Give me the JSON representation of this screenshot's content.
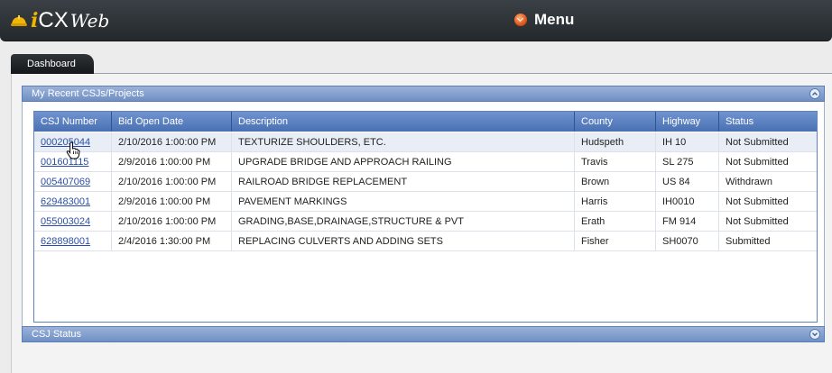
{
  "app": {
    "logo_i": "i",
    "logo_cx": "CX",
    "logo_web": "Web",
    "menu_label": "Menu"
  },
  "tabs": [
    {
      "label": "Dashboard",
      "active": true
    }
  ],
  "recent_panel": {
    "title": "My Recent CSJs/Projects",
    "columns": [
      "CSJ Number",
      "Bid Open Date",
      "Description",
      "County",
      "Highway",
      "Status"
    ],
    "rows": [
      {
        "csj": "000205044",
        "bid_open_date": "2/10/2016 1:00:00 PM",
        "description": "TEXTURIZE SHOULDERS, ETC.",
        "county": "Hudspeth",
        "highway": "IH 10",
        "status": "Not Submitted"
      },
      {
        "csj": "001601115",
        "bid_open_date": "2/9/2016 1:00:00 PM",
        "description": "UPGRADE BRIDGE AND APPROACH RAILING",
        "county": "Travis",
        "highway": "SL 275",
        "status": "Not Submitted"
      },
      {
        "csj": "005407069",
        "bid_open_date": "2/10/2016 1:00:00 PM",
        "description": "RAILROAD BRIDGE REPLACEMENT",
        "county": "Brown",
        "highway": "US 84",
        "status": "Withdrawn"
      },
      {
        "csj": "629483001",
        "bid_open_date": "2/9/2016 1:00:00 PM",
        "description": "PAVEMENT MARKINGS",
        "county": "Harris",
        "highway": "IH0010",
        "status": "Not Submitted"
      },
      {
        "csj": "055003024",
        "bid_open_date": "2/10/2016 1:00:00 PM",
        "description": "GRADING,BASE,DRAINAGE,STRUCTURE & PVT",
        "county": "Erath",
        "highway": "FM 914",
        "status": "Not Submitted"
      },
      {
        "csj": "628898001",
        "bid_open_date": "2/4/2016 1:30:00 PM",
        "description": "REPLACING CULVERTS AND ADDING SETS",
        "county": "Fisher",
        "highway": "SH0070",
        "status": "Submitted"
      }
    ]
  },
  "status_panel": {
    "title": "CSJ Status"
  },
  "colors": {
    "header_dark": "#24292d",
    "panel_blue": "#6f8fc4",
    "grid_header_blue": "#4a70b3",
    "link_blue": "#2b4fa8",
    "logo_gold": "#f0b400",
    "menu_orange": "#e0551b"
  },
  "icons": {
    "logo": "hardhat-icon",
    "menu": "menu-orb-icon",
    "collapse": "chevron-up-icon",
    "expand": "chevron-down-icon",
    "cursor": "hand-pointer-icon"
  }
}
